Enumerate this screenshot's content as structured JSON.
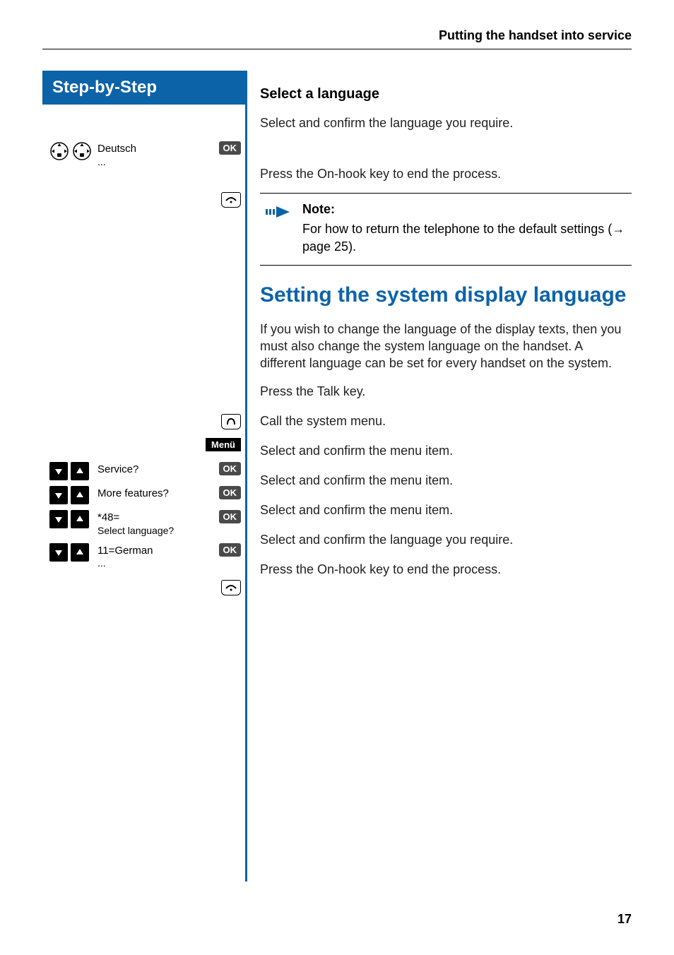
{
  "header": {
    "section_title": "Putting the handset into service"
  },
  "sidebar": {
    "title": "Step-by-Step",
    "rows": [
      {
        "label": "Deutsch",
        "sub": "...",
        "action": "OK",
        "icon_set": "nav2"
      },
      {
        "label": "",
        "action": "onhook",
        "icon_set": "none"
      },
      {
        "label": "",
        "action": "talk",
        "icon_set": "none"
      },
      {
        "label": "",
        "action": "Menü",
        "icon_set": "none"
      },
      {
        "label": "Service?",
        "action": "OK",
        "icon_set": "updown"
      },
      {
        "label": "More features?",
        "action": "OK",
        "icon_set": "updown"
      },
      {
        "label": "*48=",
        "sub": "Select language?",
        "action": "OK",
        "icon_set": "updown"
      },
      {
        "label": "11=German",
        "sub": "...",
        "action": "OK",
        "icon_set": "updown"
      },
      {
        "label": "",
        "action": "onhook",
        "icon_set": "none"
      }
    ]
  },
  "content": {
    "sub1": "Select a language",
    "p1": "Select and confirm the language you require.",
    "p2": "Press the On-hook key to end the process.",
    "note_title": "Note:",
    "note_body_a": "For how to return the telephone to the default settings (",
    "note_body_arrow": "→",
    "note_body_b": " page 25).",
    "h2": "Setting the system display language",
    "p3": "If you wish to change the language of the display texts, then you must also change the system language on the handset. A different language can be set for every handset on the system.",
    "p4": "Press the Talk key.",
    "p5": "Call the system menu.",
    "p6": "Select and confirm the menu item.",
    "p7": "Select and confirm the menu item.",
    "p8": "Select and confirm the menu item.",
    "p9": "Select and confirm the language you require.",
    "p10": "Press the On-hook key to end the process."
  },
  "page_number": "17"
}
